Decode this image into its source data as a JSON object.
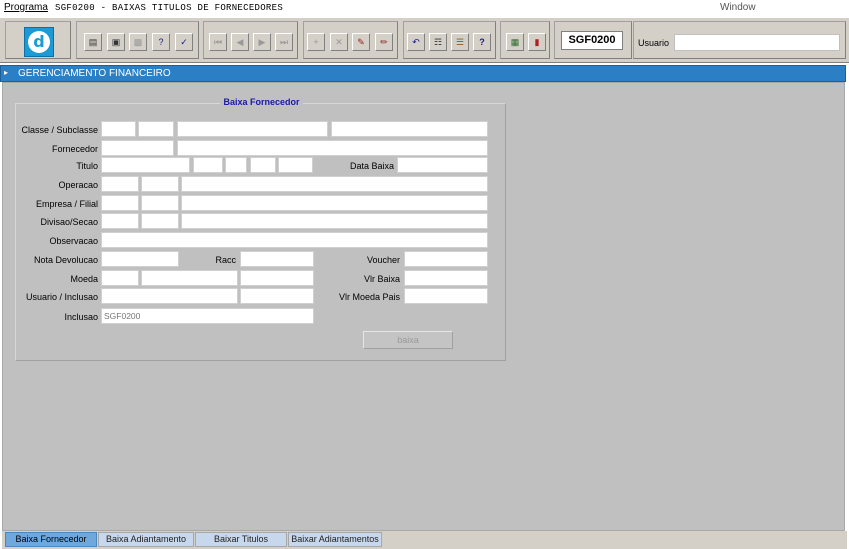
{
  "menu": {
    "programa": "Programa",
    "title": "SGF0200 - BAIXAS TITULOS DE FORNECEDORES",
    "window": "Window"
  },
  "toolbar": {
    "program_code": "SGF0200",
    "usuario_label": "Usuario",
    "usuario_value": ""
  },
  "panel": {
    "header": "GERENCIAMENTO FINANCEIRO",
    "group_title": "Baixa Fornecedor"
  },
  "form": {
    "labels": {
      "classe": "Classe / Subclasse",
      "fornecedor": "Fornecedor",
      "titulo": "Titulo",
      "data_baixa": "Data Baixa",
      "operacao": "Operacao",
      "empresa": "Empresa / Filial",
      "divisao": "Divisao/Secao",
      "observacao": "Observacao",
      "nota_devolucao": "Nota Devolucao",
      "racc": "Racc",
      "voucher": "Voucher",
      "moeda": "Moeda",
      "vlr_baixa": "Vlr Baixa",
      "usuario_inclusao": "Usuario / Inclusao",
      "vlr_moeda_pais": "Vlr Moeda Pais",
      "inclusao": "Inclusao"
    },
    "values": {
      "inclusao": "SGF0200"
    },
    "baixa_button": "baixa"
  },
  "tabs": [
    {
      "label": "Baixa Fornecedor",
      "active": true
    },
    {
      "label": "Baixa Adiantamento",
      "active": false
    },
    {
      "label": "Baixar Titulos",
      "active": false
    },
    {
      "label": "Baixar Adiantamentos",
      "active": false
    }
  ]
}
